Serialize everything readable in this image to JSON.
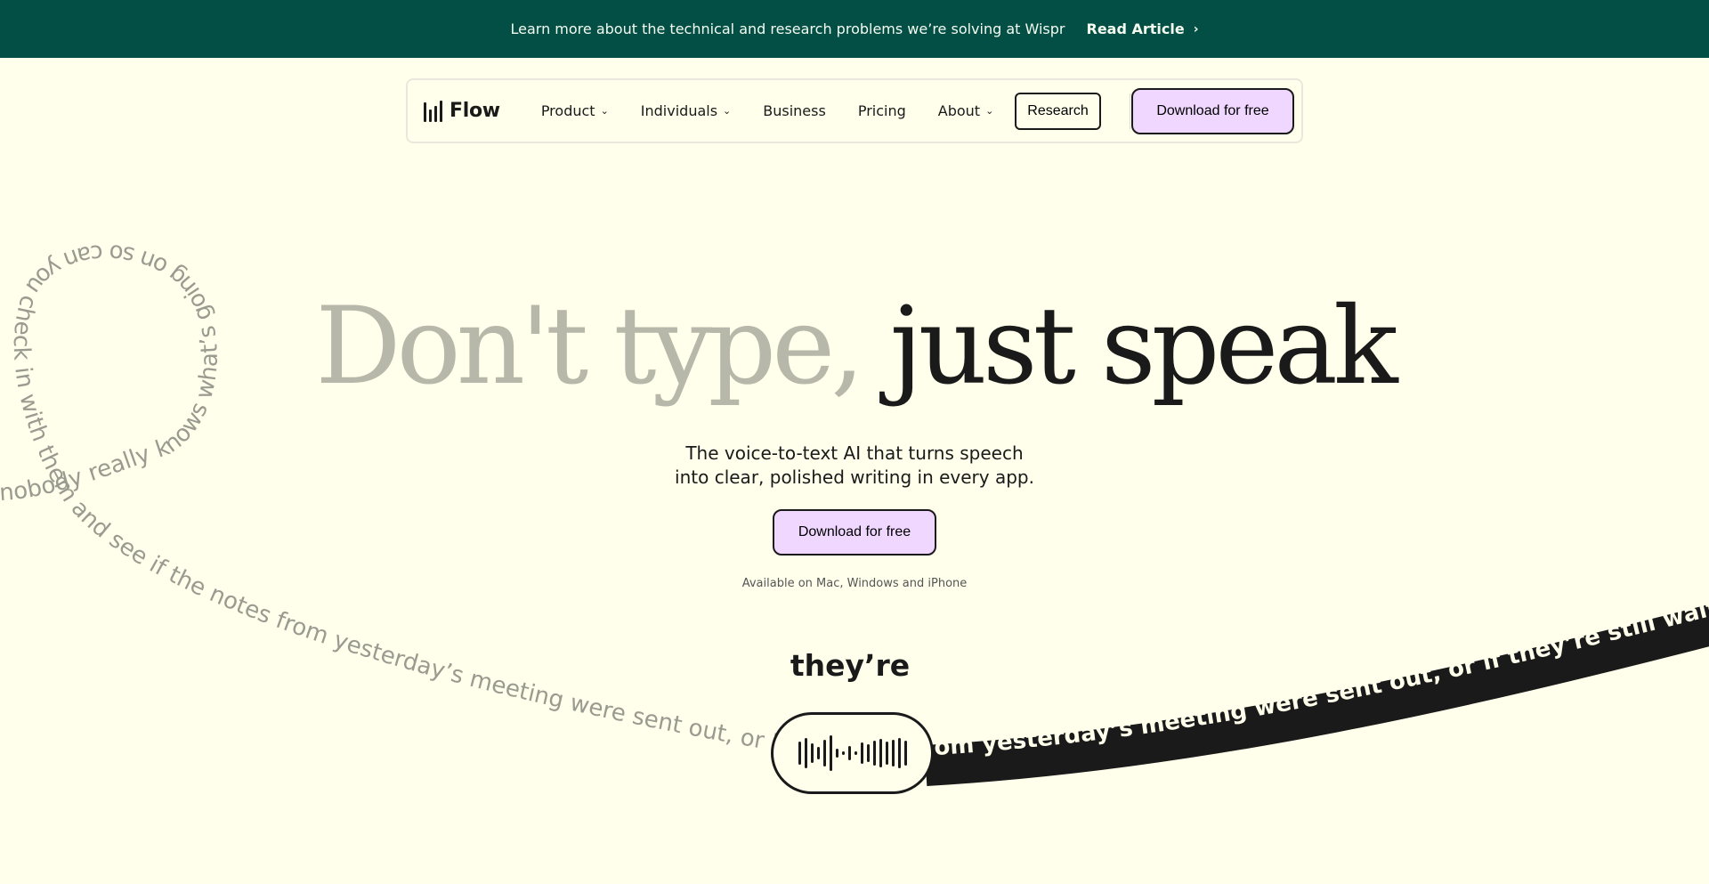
{
  "banner": {
    "text": "Learn more about the technical and research problems we’re solving at Wispr",
    "link_label": "Read Article",
    "link_icon": "chevron-right-icon"
  },
  "nav": {
    "logo_text": "Flow",
    "items": [
      {
        "label": "Product",
        "has_dropdown": true
      },
      {
        "label": "Individuals",
        "has_dropdown": true
      },
      {
        "label": "Business",
        "has_dropdown": false
      },
      {
        "label": "Pricing",
        "has_dropdown": false
      },
      {
        "label": "About",
        "has_dropdown": true
      }
    ],
    "research_label": "Research",
    "download_label": "Download for free"
  },
  "hero": {
    "title_light": "Don't type,",
    "title_dark": "just speak",
    "subtitle_line1": "The voice-to-text AI that turns speech",
    "subtitle_line2": "into clear, polished writing in every app.",
    "download_label": "Download for free",
    "available": "Available on Mac, Windows and iPhone",
    "current_word": "they’re"
  },
  "transcript": {
    "spoken_text": "nobody really knows what’s going on so can you check in with them and see if the notes from yesterday’s meeting were sent out, or if they’r",
    "output_text": "om yesterday’s meeting were sent out, or if they’re still waiting? I thin"
  },
  "colors": {
    "background": "#FFFFEB",
    "banner": "#034F46",
    "accent_button": "#F0D7FF",
    "light_title": "#B8B8AA",
    "ribbon": "#1a1a1a"
  }
}
